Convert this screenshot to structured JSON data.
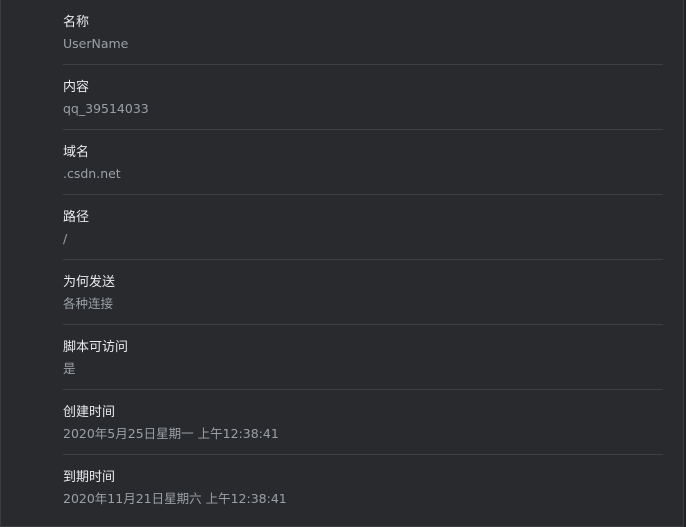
{
  "cookie_properties": [
    {
      "label": "名称",
      "value": "UserName"
    },
    {
      "label": "内容",
      "value": "qq_39514033"
    },
    {
      "label": "域名",
      "value": ".csdn.net"
    },
    {
      "label": "路径",
      "value": "/"
    },
    {
      "label": "为何发送",
      "value": "各种连接"
    },
    {
      "label": "脚本可访问",
      "value": "是"
    },
    {
      "label": "创建时间",
      "value": "2020年5月25日星期一 上午12:38:41"
    },
    {
      "label": "到期时间",
      "value": "2020年11月21日星期六 上午12:38:41"
    }
  ],
  "colors": {
    "background": "#292a2d",
    "label": "#e8eaed",
    "value": "#9aa0a6",
    "divider": "#3f4043"
  }
}
